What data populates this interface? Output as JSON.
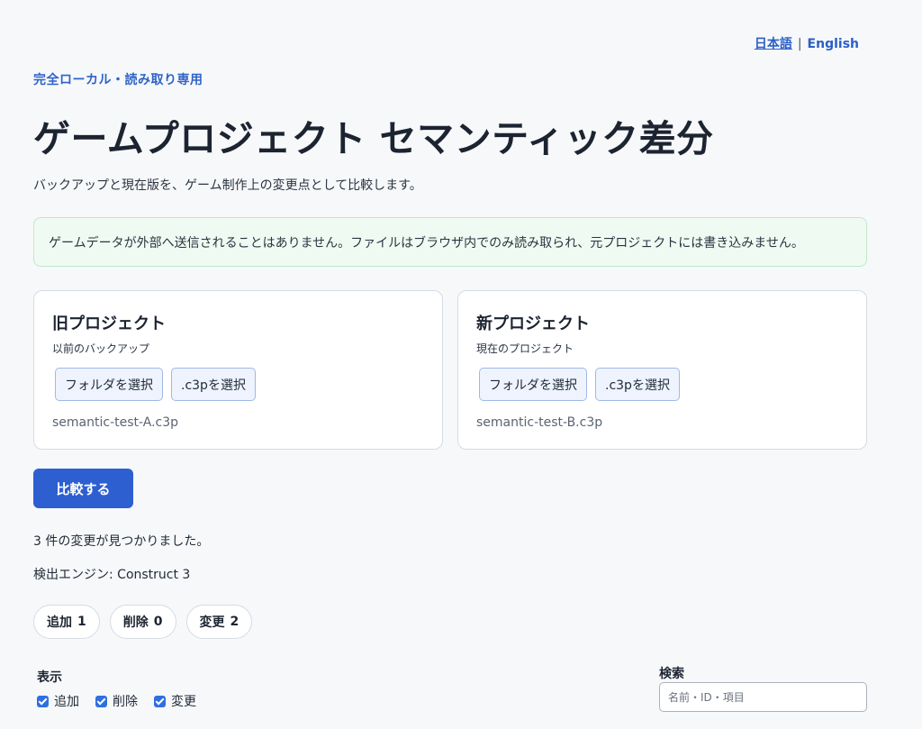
{
  "lang": {
    "ja": "日本語",
    "separator": "|",
    "en": "English"
  },
  "header": {
    "eyebrow": "完全ローカル・読み取り専用",
    "title": "ゲームプロジェクト セマンティック差分",
    "subtitle": "バックアップと現在版を、ゲーム制作上の変更点として比較します。"
  },
  "notice": "ゲームデータが外部へ送信されることはありません。ファイルはブラウザ内でのみ読み取られ、元プロジェクトには書き込みません。",
  "old_project": {
    "title": "旧プロジェクト",
    "subtitle": "以前のバックアップ",
    "folder_button": "フォルダを選択",
    "c3p_button": ".c3pを選択",
    "file_name": "semantic-test-A.c3p"
  },
  "new_project": {
    "title": "新プロジェクト",
    "subtitle": "現在のプロジェクト",
    "folder_button": "フォルダを選択",
    "c3p_button": ".c3pを選択",
    "file_name": "semantic-test-B.c3p"
  },
  "compare_button": "比較する",
  "results": {
    "count_text": "3 件の変更が見つかりました。",
    "engine_text": "検出エンジン: Construct 3"
  },
  "summary_pills": [
    {
      "label": "追加",
      "count": "1"
    },
    {
      "label": "削除",
      "count": "0"
    },
    {
      "label": "変更",
      "count": "2"
    }
  ],
  "display_filter": {
    "label": "表示",
    "options": [
      {
        "label": "追加",
        "checked": true
      },
      {
        "label": "削除",
        "checked": true
      },
      {
        "label": "変更",
        "checked": true
      }
    ]
  },
  "search": {
    "label": "検索",
    "placeholder": "名前・ID・項目",
    "value": ""
  },
  "colors": {
    "accent": "#2d5fd1",
    "background": "#f7f8fa",
    "notice_bg": "#effbf2",
    "notice_border": "#bfe8c9"
  }
}
